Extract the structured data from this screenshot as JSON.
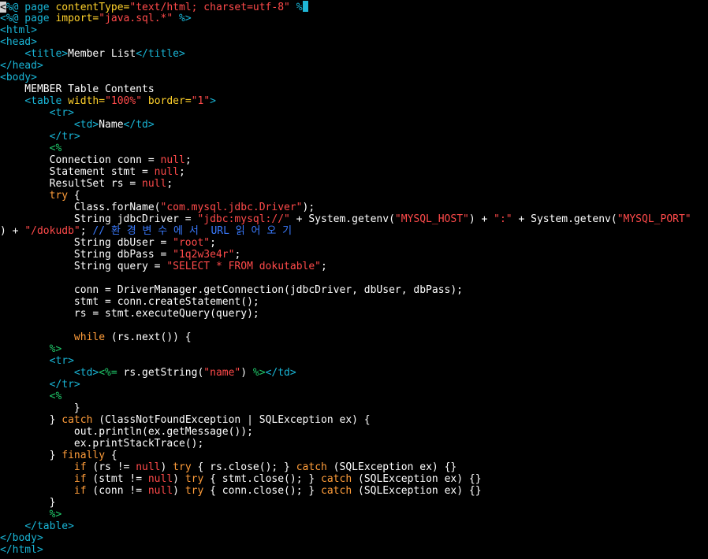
{
  "editor": {
    "colors": {
      "background": "#000000",
      "default_text": "#ffffff",
      "tag": "#19b5d6",
      "attribute": "#ffd12b",
      "string": "#ff4a4a",
      "keyword": "#ff9d3a",
      "comment": "#3a7bff",
      "directive": "#20c96a"
    },
    "lines": [
      {
        "i": 0,
        "segs": [
          [
            "cursor",
            "<"
          ],
          [
            "cyan",
            "%@ page "
          ],
          [
            "yellow",
            "contentType="
          ],
          [
            "red",
            "\"text/html; charset=utf-8\""
          ],
          [
            "cyan",
            " %"
          ],
          [
            "caret",
            ""
          ]
        ]
      },
      {
        "i": 1,
        "segs": [
          [
            "cyan",
            "<%@ page "
          ],
          [
            "yellow",
            "import="
          ],
          [
            "red",
            "\"java.sql.*\""
          ],
          [
            "cyan",
            " %>"
          ]
        ]
      },
      {
        "i": 2,
        "segs": [
          [
            "cyan",
            "<html>"
          ]
        ]
      },
      {
        "i": 3,
        "segs": [
          [
            "cyan",
            "<head>"
          ]
        ]
      },
      {
        "i": 4,
        "segs": [
          [
            "white",
            "    "
          ],
          [
            "cyan",
            "<title>"
          ],
          [
            "white",
            "Member List"
          ],
          [
            "cyan",
            "</title>"
          ]
        ]
      },
      {
        "i": 5,
        "segs": [
          [
            "cyan",
            "</head>"
          ]
        ]
      },
      {
        "i": 6,
        "segs": [
          [
            "cyan",
            "<body>"
          ]
        ]
      },
      {
        "i": 7,
        "segs": [
          [
            "white",
            "    MEMBER Table Contents"
          ]
        ]
      },
      {
        "i": 8,
        "segs": [
          [
            "white",
            "    "
          ],
          [
            "cyan",
            "<table "
          ],
          [
            "yellow",
            "width="
          ],
          [
            "red",
            "\"100%\""
          ],
          [
            "yellow",
            " border="
          ],
          [
            "red",
            "\"1\""
          ],
          [
            "cyan",
            ">"
          ]
        ]
      },
      {
        "i": 9,
        "segs": [
          [
            "white",
            "        "
          ],
          [
            "cyan",
            "<tr>"
          ]
        ]
      },
      {
        "i": 10,
        "segs": [
          [
            "white",
            "            "
          ],
          [
            "cyan",
            "<td>"
          ],
          [
            "white",
            "Name"
          ],
          [
            "cyan",
            "</td>"
          ]
        ]
      },
      {
        "i": 11,
        "segs": [
          [
            "white",
            "        "
          ],
          [
            "cyan",
            "</tr>"
          ]
        ]
      },
      {
        "i": 12,
        "segs": [
          [
            "white",
            "        "
          ],
          [
            "green",
            "<%"
          ]
        ]
      },
      {
        "i": 13,
        "segs": [
          [
            "white",
            "        Connection conn = "
          ],
          [
            "red",
            "null"
          ],
          [
            "white",
            ";"
          ]
        ]
      },
      {
        "i": 14,
        "segs": [
          [
            "white",
            "        Statement stmt = "
          ],
          [
            "red",
            "null"
          ],
          [
            "white",
            ";"
          ]
        ]
      },
      {
        "i": 15,
        "segs": [
          [
            "white",
            "        ResultSet rs = "
          ],
          [
            "red",
            "null"
          ],
          [
            "white",
            ";"
          ]
        ]
      },
      {
        "i": 16,
        "segs": [
          [
            "white",
            "        "
          ],
          [
            "orange",
            "try"
          ],
          [
            "white",
            " {"
          ]
        ]
      },
      {
        "i": 17,
        "segs": [
          [
            "white",
            "            Class.forName("
          ],
          [
            "red",
            "\"com.mysql.jdbc.Driver\""
          ],
          [
            "white",
            ");"
          ]
        ]
      },
      {
        "i": 18,
        "segs": [
          [
            "white",
            "            String jdbcDriver = "
          ],
          [
            "red",
            "\"jdbc:mysql://\""
          ],
          [
            "white",
            " + System.getenv("
          ],
          [
            "red",
            "\"MYSQL_HOST\""
          ],
          [
            "white",
            ") + "
          ],
          [
            "red",
            "\":\""
          ],
          [
            "white",
            " + System.getenv("
          ],
          [
            "red",
            "\"MYSQL_PORT\""
          ]
        ]
      },
      {
        "i": 19,
        "segs": [
          [
            "white",
            ") + "
          ],
          [
            "red",
            "\"/dokudb\""
          ],
          [
            "white",
            "; "
          ],
          [
            "blue",
            "// 환 경 변 수 에 서  URL 읽 어 오 기"
          ]
        ]
      },
      {
        "i": 20,
        "segs": [
          [
            "white",
            "            String dbUser = "
          ],
          [
            "red",
            "\"root\""
          ],
          [
            "white",
            ";"
          ]
        ]
      },
      {
        "i": 21,
        "segs": [
          [
            "white",
            "            String dbPass = "
          ],
          [
            "red",
            "\"1q2w3e4r\""
          ],
          [
            "white",
            ";"
          ]
        ]
      },
      {
        "i": 22,
        "segs": [
          [
            "white",
            "            String query = "
          ],
          [
            "red",
            "\"SELECT * FROM dokutable\""
          ],
          [
            "white",
            ";"
          ]
        ]
      },
      {
        "i": 23,
        "segs": [
          [
            "white",
            ""
          ]
        ]
      },
      {
        "i": 24,
        "segs": [
          [
            "white",
            "            conn = DriverManager.getConnection(jdbcDriver, dbUser, dbPass);"
          ]
        ]
      },
      {
        "i": 25,
        "segs": [
          [
            "white",
            "            stmt = conn.createStatement();"
          ]
        ]
      },
      {
        "i": 26,
        "segs": [
          [
            "white",
            "            rs = stmt.executeQuery(query);"
          ]
        ]
      },
      {
        "i": 27,
        "segs": [
          [
            "white",
            ""
          ]
        ]
      },
      {
        "i": 28,
        "segs": [
          [
            "white",
            "            "
          ],
          [
            "orange",
            "while"
          ],
          [
            "white",
            " (rs.next()) {"
          ]
        ]
      },
      {
        "i": 29,
        "segs": [
          [
            "white",
            "        "
          ],
          [
            "green",
            "%>"
          ]
        ]
      },
      {
        "i": 30,
        "segs": [
          [
            "white",
            "        "
          ],
          [
            "cyan",
            "<tr>"
          ]
        ]
      },
      {
        "i": 31,
        "segs": [
          [
            "white",
            "            "
          ],
          [
            "cyan",
            "<td>"
          ],
          [
            "green",
            "<%="
          ],
          [
            "white",
            " rs.getString("
          ],
          [
            "red",
            "\"name\""
          ],
          [
            "white",
            ") "
          ],
          [
            "green",
            "%>"
          ],
          [
            "cyan",
            "</td>"
          ]
        ]
      },
      {
        "i": 32,
        "segs": [
          [
            "white",
            "        "
          ],
          [
            "cyan",
            "</tr>"
          ]
        ]
      },
      {
        "i": 33,
        "segs": [
          [
            "white",
            "        "
          ],
          [
            "green",
            "<%"
          ]
        ]
      },
      {
        "i": 34,
        "segs": [
          [
            "white",
            "            }"
          ]
        ]
      },
      {
        "i": 35,
        "segs": [
          [
            "white",
            "        } "
          ],
          [
            "orange",
            "catch"
          ],
          [
            "white",
            " (ClassNotFoundException | SQLException ex) {"
          ]
        ]
      },
      {
        "i": 36,
        "segs": [
          [
            "white",
            "            out.println(ex.getMessage());"
          ]
        ]
      },
      {
        "i": 37,
        "segs": [
          [
            "white",
            "            ex.printStackTrace();"
          ]
        ]
      },
      {
        "i": 38,
        "segs": [
          [
            "white",
            "        } "
          ],
          [
            "orange",
            "finally"
          ],
          [
            "white",
            " {"
          ]
        ]
      },
      {
        "i": 39,
        "segs": [
          [
            "white",
            "            "
          ],
          [
            "orange",
            "if"
          ],
          [
            "white",
            " (rs != "
          ],
          [
            "red",
            "null"
          ],
          [
            "white",
            ") "
          ],
          [
            "orange",
            "try"
          ],
          [
            "white",
            " { rs.close(); } "
          ],
          [
            "orange",
            "catch"
          ],
          [
            "white",
            " (SQLException ex) {}"
          ]
        ]
      },
      {
        "i": 40,
        "segs": [
          [
            "white",
            "            "
          ],
          [
            "orange",
            "if"
          ],
          [
            "white",
            " (stmt != "
          ],
          [
            "red",
            "null"
          ],
          [
            "white",
            ") "
          ],
          [
            "orange",
            "try"
          ],
          [
            "white",
            " { stmt.close(); } "
          ],
          [
            "orange",
            "catch"
          ],
          [
            "white",
            " (SQLException ex) {}"
          ]
        ]
      },
      {
        "i": 41,
        "segs": [
          [
            "white",
            "            "
          ],
          [
            "orange",
            "if"
          ],
          [
            "white",
            " (conn != "
          ],
          [
            "red",
            "null"
          ],
          [
            "white",
            ") "
          ],
          [
            "orange",
            "try"
          ],
          [
            "white",
            " { conn.close(); } "
          ],
          [
            "orange",
            "catch"
          ],
          [
            "white",
            " (SQLException ex) {}"
          ]
        ]
      },
      {
        "i": 42,
        "segs": [
          [
            "white",
            "        }"
          ]
        ]
      },
      {
        "i": 43,
        "segs": [
          [
            "white",
            "        "
          ],
          [
            "green",
            "%>"
          ]
        ]
      },
      {
        "i": 44,
        "segs": [
          [
            "white",
            "    "
          ],
          [
            "cyan",
            "</table>"
          ]
        ]
      },
      {
        "i": 45,
        "segs": [
          [
            "cyan",
            "</body>"
          ]
        ]
      },
      {
        "i": 46,
        "segs": [
          [
            "cyan",
            "</html>"
          ]
        ]
      }
    ]
  }
}
